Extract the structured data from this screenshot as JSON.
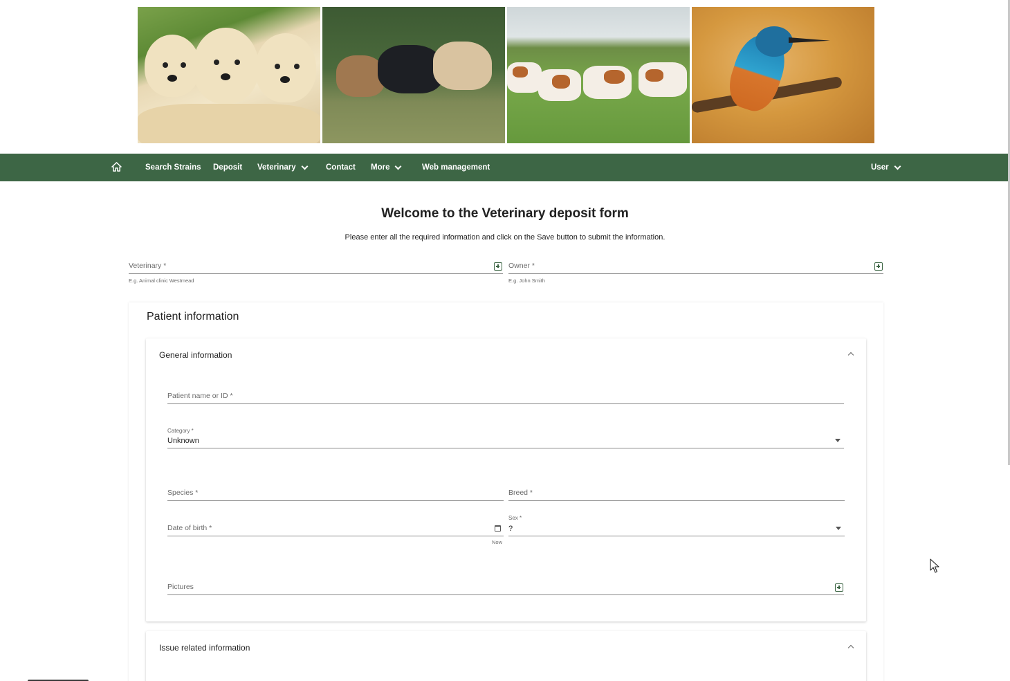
{
  "banner": {
    "images": [
      "puppies",
      "horses",
      "cows",
      "kingfisher"
    ]
  },
  "nav": {
    "home_icon": "home-icon",
    "items": [
      {
        "label": "Search Strains"
      },
      {
        "label": "Deposit"
      },
      {
        "label": "Veterinary"
      },
      {
        "label": "Contact"
      },
      {
        "label": "More"
      },
      {
        "label": "Web management"
      }
    ],
    "user_label": "User",
    "background": "#3d6645"
  },
  "page": {
    "title": "Welcome to the Veterinary deposit form",
    "subtitle": "Please enter all the required information and click on the Save button to submit the information."
  },
  "form": {
    "veterinary": {
      "label": "Veterinary *",
      "hint": "E.g. Animal clinic Westmead"
    },
    "owner": {
      "label": "Owner *",
      "hint": "E.g. John Smith"
    }
  },
  "patient": {
    "title": "Patient information",
    "general": {
      "title": "General information",
      "patient_name": {
        "label": "Patient name or ID *"
      },
      "category": {
        "label": "Category *",
        "value": "Unknown"
      },
      "species": {
        "label": "Species *"
      },
      "breed": {
        "label": "Breed *"
      },
      "dob": {
        "label": "Date of birth *",
        "hint": "Now"
      },
      "sex": {
        "label": "Sex *",
        "value": "?"
      },
      "pictures": {
        "label": "Pictures"
      }
    },
    "issue": {
      "title": "Issue related information"
    }
  }
}
